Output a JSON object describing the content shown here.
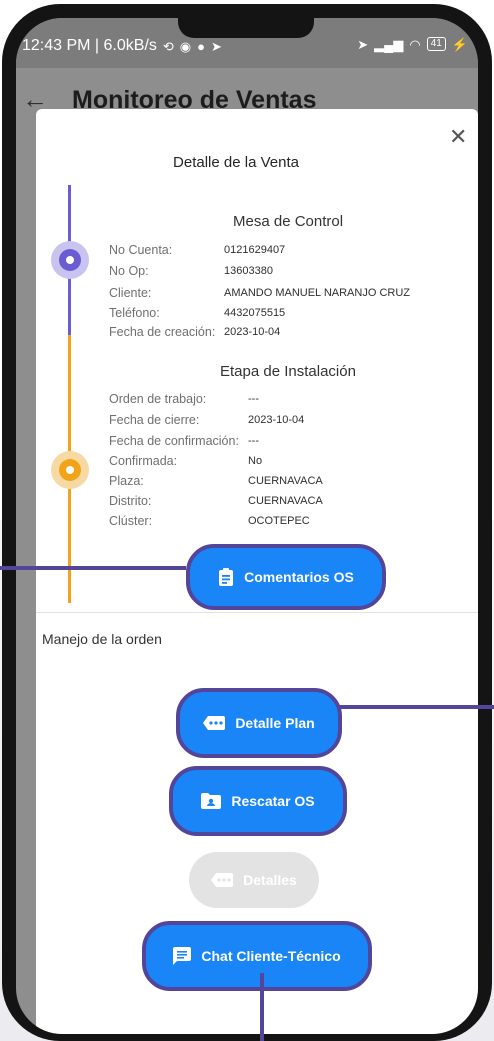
{
  "status_bar": {
    "time": "12:43 PM | 6.0kB/s",
    "battery": "41"
  },
  "app_bar": {
    "title": "Monitoreo de Ventas"
  },
  "modal": {
    "title": "Detalle de la Venta",
    "mesa_control": {
      "title": "Mesa de Control",
      "rows": [
        {
          "label": "No Cuenta:",
          "value": "0121629407"
        },
        {
          "label": "No Op:",
          "value": "13603380"
        },
        {
          "label": "Cliente:",
          "value": "AMANDO MANUEL NARANJO CRUZ"
        },
        {
          "label": "Teléfono:",
          "value": "4432075515"
        },
        {
          "label": "Fecha de creación:",
          "value": "2023-10-04"
        }
      ]
    },
    "instalacion": {
      "title": "Etapa de Instalación",
      "rows": [
        {
          "label": "Orden de trabajo:",
          "value": "---"
        },
        {
          "label": "Fecha de cierre:",
          "value": "2023-10-04"
        },
        {
          "label": "Fecha de confirmación:",
          "value": "---"
        },
        {
          "label": "Confirmada:",
          "value": "No"
        },
        {
          "label": "Plaza:",
          "value": "CUERNAVACA"
        },
        {
          "label": "Distrito:",
          "value": "CUERNAVACA"
        },
        {
          "label": "Clúster:",
          "value": "OCOTEPEC"
        }
      ]
    },
    "comentarios_button": "Comentarios OS",
    "order_section_title": "Manejo de la orden",
    "buttons": {
      "detalle_plan": "Detalle Plan",
      "rescatar_os": "Rescatar OS",
      "detalles": "Detalles",
      "chat": "Chat Cliente-Técnico"
    }
  },
  "colors": {
    "primary_button": "#1a85f6",
    "highlight_outline": "#53469a",
    "timeline_purple": "#6a5cd1",
    "timeline_orange": "#f1a31a"
  }
}
